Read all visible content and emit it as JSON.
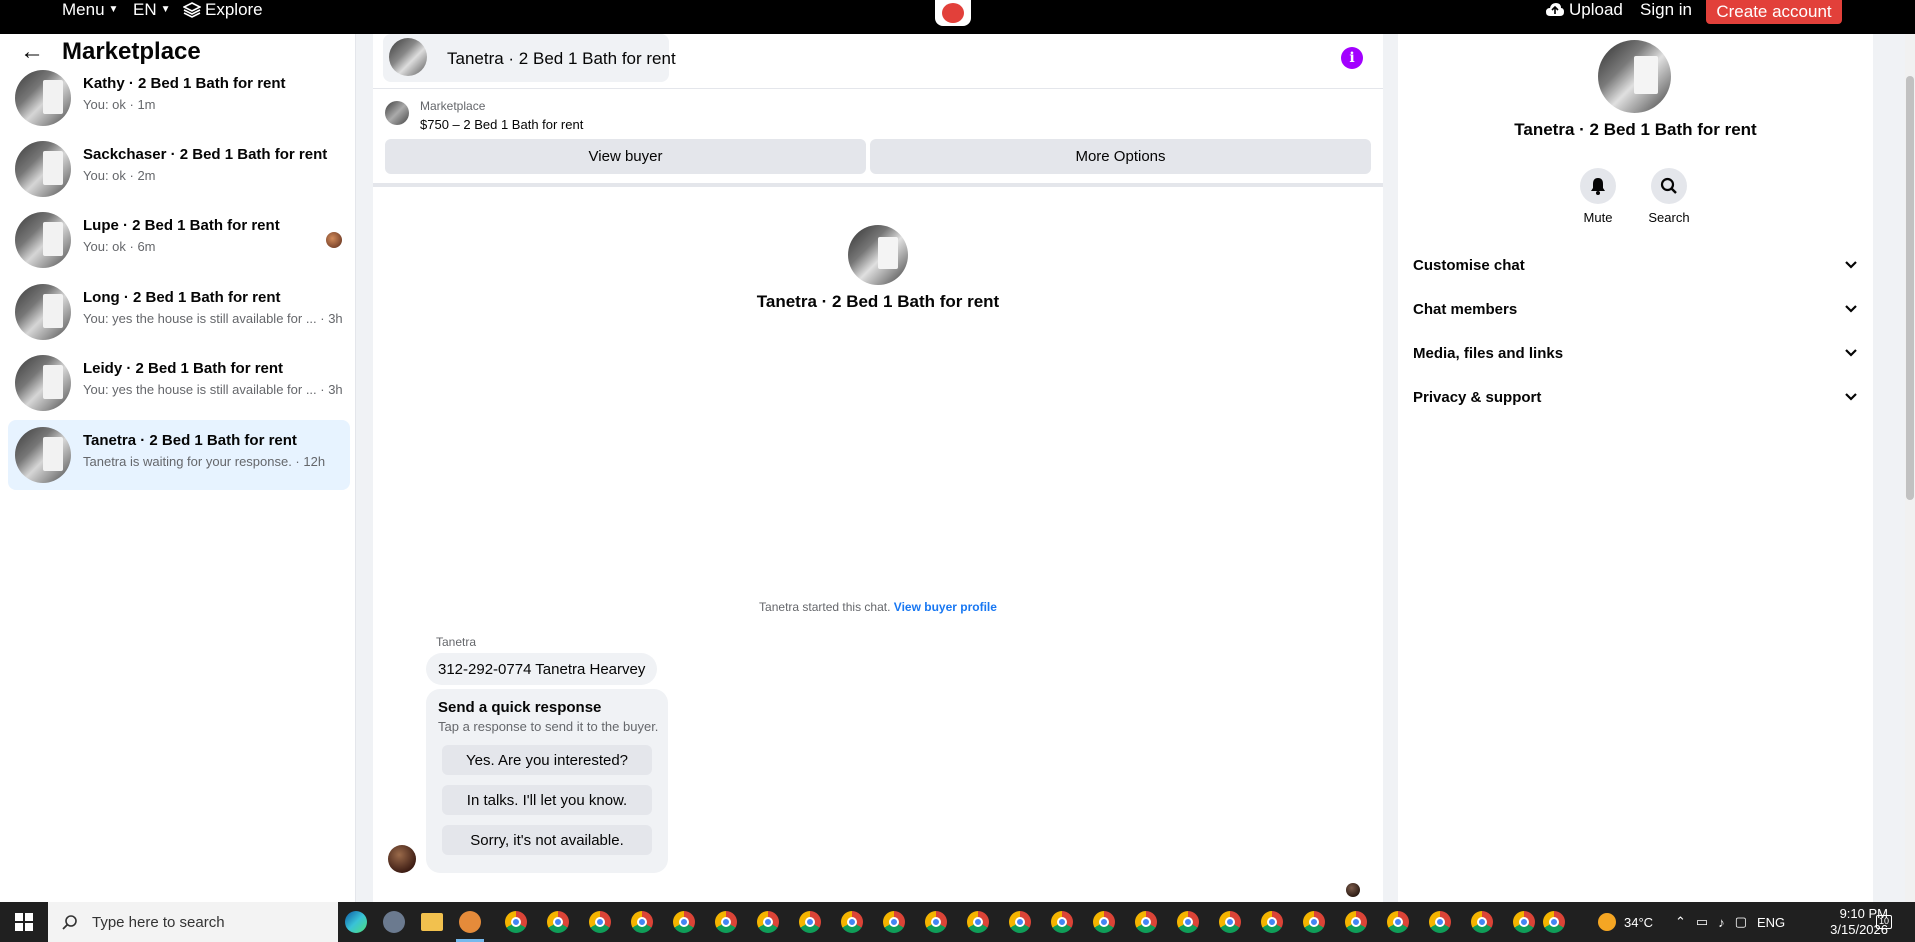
{
  "topbar": {
    "menu": "Menu",
    "lang": "EN",
    "explore": "Explore",
    "upload": "Upload",
    "signin": "Sign in",
    "create": "Create account"
  },
  "left": {
    "title": "Marketplace",
    "conversations": [
      {
        "title": "Kathy · 2 Bed 1 Bath for rent",
        "sub": "You: ok · 1m"
      },
      {
        "title": "Sackchaser · 2 Bed 1 Bath for rent",
        "sub": "You: ok · 2m"
      },
      {
        "title": "Lupe · 2 Bed 1 Bath for rent",
        "sub": "You: ok · 6m"
      },
      {
        "title": "Long · 2 Bed 1 Bath for rent",
        "sub": "You: yes the house is still available for ... · 3h"
      },
      {
        "title": "Leidy · 2 Bed 1 Bath for rent",
        "sub": "You: yes the house is still available for ... · 3h"
      },
      {
        "title": "Tanetra · 2 Bed 1 Bath for rent",
        "sub": "Tanetra is waiting for your response. · 12h"
      }
    ]
  },
  "chat": {
    "header_name": "Tanetra · 2 Bed 1 Bath for rent",
    "info_icon": "i",
    "marketplace_label": "Marketplace",
    "listing": "$750 – 2 Bed 1 Bath for rent",
    "view_buyer": "View buyer",
    "more_options": "More Options",
    "center_name": "Tanetra · 2 Bed 1 Bath for rent",
    "started_text": "Tanetra started this chat.",
    "view_buyer_profile": "View buyer profile",
    "sender": "Tanetra",
    "message": "312-292-0774 Tanetra Hearvey",
    "quick_title": "Send a quick response",
    "quick_sub": "Tap a response to send it to the buyer.",
    "quick_replies": [
      "Yes. Are you interested?",
      "In talks. I'll let you know.",
      "Sorry, it's not available."
    ]
  },
  "right": {
    "name": "Tanetra · 2 Bed 1 Bath for rent",
    "mute": "Mute",
    "search": "Search",
    "rows": [
      "Customise chat",
      "Chat members",
      "Media, files and links",
      "Privacy & support"
    ]
  },
  "taskbar": {
    "search_placeholder": "Type here to search",
    "temperature": "34°C",
    "lang": "ENG",
    "time": "9:10 PM",
    "date": "3/15/2026",
    "notification_count": "10"
  },
  "colors": {
    "accent_red": "#e2403a",
    "link_blue": "#1877f2",
    "info_purple": "#a200ff",
    "active_bg": "#e7f3ff"
  }
}
